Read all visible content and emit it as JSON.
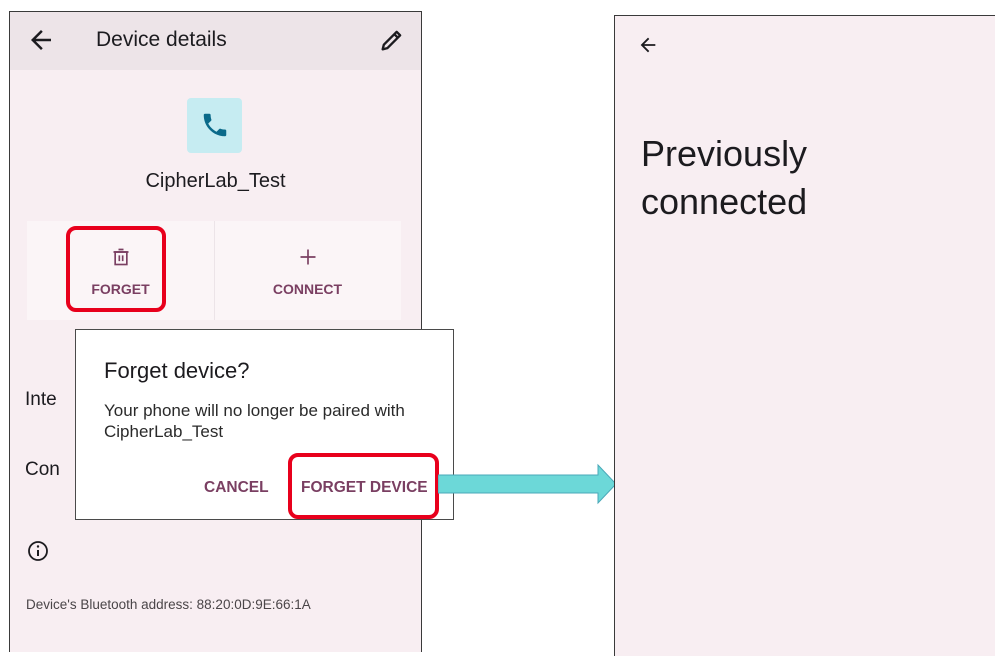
{
  "left_screen": {
    "header": {
      "title": "Device details"
    },
    "device": {
      "name": "CipherLab_Test"
    },
    "actions": {
      "forget_label": "FORGET",
      "connect_label": "CONNECT"
    },
    "background_rows": {
      "row1": "Inte",
      "row2": "Con"
    },
    "bt_address": "Device's Bluetooth address: 88:20:0D:9E:66:1A"
  },
  "dialog": {
    "title": "Forget device?",
    "message": "Your phone will no longer be paired with CipherLab_Test",
    "cancel_label": "CANCEL",
    "confirm_label": "FORGET DEVICE"
  },
  "right_screen": {
    "title": "Previously connected"
  },
  "colors": {
    "accent": "#7a3f62",
    "screen_bg": "#f8eef2",
    "highlight": "#e8001c",
    "arrow": "#6cd8d8",
    "device_icon_bg": "#c6ecf2"
  }
}
